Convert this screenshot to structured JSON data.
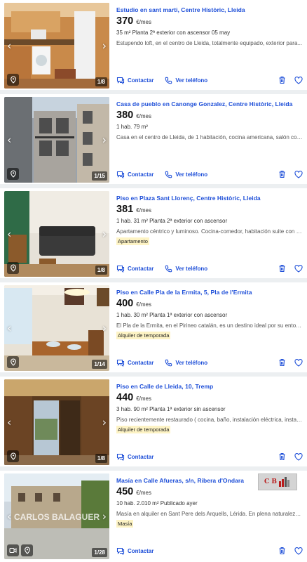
{
  "listings": [
    {
      "title": "Estudio en sant marti, Centre Històric, Lleida",
      "price": "370",
      "price_unit": "€/mes",
      "features": "35 m²  Planta 2ª exterior con ascensor  05 may",
      "description": "Estupendo loft, en el centro de Lleida, totalmente equipado, exterior para...",
      "tag": "",
      "photo_counter": "1/8",
      "contact_label": "Contactar",
      "phone_label": "Ver teléfono"
    },
    {
      "title": "Casa de pueblo en Canonge Gonzalez, Centre Històric, Lleida",
      "price": "380",
      "price_unit": "€/mes",
      "features": "1 hab.  79 m²",
      "description": "Casa en el centro de Lleida, de 1 habitación, cocina americana, salón comedo...",
      "tag": "",
      "photo_counter": "1/15",
      "contact_label": "Contactar",
      "phone_label": "Ver teléfono"
    },
    {
      "title": "Piso en Plaza Sant Llorenç, Centre Històric, Lleida",
      "price": "381",
      "price_unit": "€/mes",
      "features": "1 hab.  31 m²  Planta 2ª exterior con ascensor",
      "description": "Apartamento céntrico y luminoso. Cocina-comedor, habitación suite con ca...",
      "tag": "Apartamento",
      "photo_counter": "1/8",
      "contact_label": "Contactar",
      "phone_label": "Ver teléfono"
    },
    {
      "title": "Piso en Calle Pla de la Ermita, 5, Pla de l'Ermita",
      "price": "400",
      "price_unit": "€/mes",
      "features": "1 hab.  30 m²  Planta 1ª exterior con ascensor",
      "description": "El Pla de la Ermita, en el Pirineo catalán, es un destino ideal por su entorno...",
      "tag": "Alquiler de temporada",
      "photo_counter": "1/14",
      "contact_label": "Contactar",
      "phone_label": "Ver teléfono"
    },
    {
      "title": "Piso en Calle de Lleida, 10, Tremp",
      "price": "440",
      "price_unit": "€/mes",
      "features": "3 hab.  90 m²  Planta 1ª exterior sin ascensor",
      "description": "Piso recientemente restaurado ( cocina, baño, instalación eléctrica, instalaci...",
      "tag": "Alquiler de temporada",
      "photo_counter": "1/8",
      "contact_label": "Contactar",
      "phone_label": ""
    },
    {
      "title": "Masía en Calle Afueras, s/n, Ribera d'Ondara",
      "price": "450",
      "price_unit": "€/mes",
      "features": "10 hab.  2.010 m²  Publicado ayer",
      "description": "Masía en alquiler en Sant Pere dels Arquells, Lérida. En plena naturaleza, co...",
      "tag": "Masía",
      "photo_counter": "1/28",
      "contact_label": "Contactar",
      "phone_label": "",
      "watermark": "CARLOS BALAGUER",
      "agency_logo_text": "C B"
    }
  ],
  "colors": {
    "link_blue": "#1d4ed8",
    "tag_bg": "#fdf3c4",
    "page_bg": "#eceff1"
  },
  "icons": {
    "prev": "chevron-left-icon",
    "next": "chevron-right-icon",
    "contact": "chat-icon",
    "phone": "phone-icon",
    "discard": "trash-icon",
    "favorite": "heart-icon",
    "map": "map-pin-icon",
    "video": "video-icon"
  }
}
